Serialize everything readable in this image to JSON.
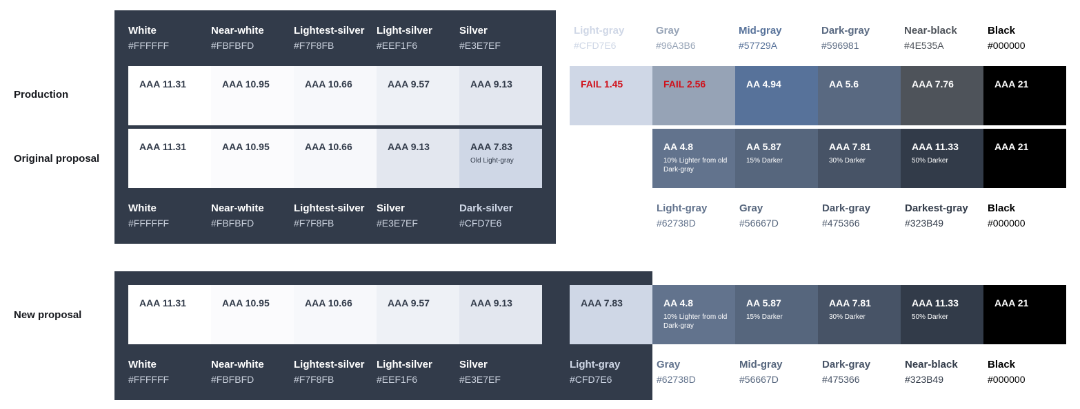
{
  "rows": {
    "production": "Production",
    "original": "Original proposal",
    "new": "New proposal"
  },
  "production": {
    "labels": [
      {
        "name": "White",
        "hex": "#FFFFFF",
        "name_color": "#ffffff",
        "hex_color": "#c9d0dc"
      },
      {
        "name": "Near-white",
        "hex": "#FBFBFD",
        "name_color": "#ffffff",
        "hex_color": "#c9d0dc"
      },
      {
        "name": "Lightest-silver",
        "hex": "#F7F8FB",
        "name_color": "#ffffff",
        "hex_color": "#c9d0dc"
      },
      {
        "name": "Light-silver",
        "hex": "#EEF1F6",
        "name_color": "#ffffff",
        "hex_color": "#c9d0dc"
      },
      {
        "name": "Silver",
        "hex": "#E3E7EF",
        "name_color": "#ffffff",
        "hex_color": "#c9d0dc"
      },
      {
        "name": "Light-gray",
        "hex": "#CFD7E6",
        "name_color": "#CFD7E6",
        "hex_color": "#CFD7E6"
      },
      {
        "name": "Gray",
        "hex": "#96A3B6",
        "name_color": "#96A3B6",
        "hex_color": "#96A3B6"
      },
      {
        "name": "Mid-gray",
        "hex": "#57729A",
        "name_color": "#57729A",
        "hex_color": "#57729A"
      },
      {
        "name": "Dark-gray",
        "hex": "#596981",
        "name_color": "#596981",
        "hex_color": "#596981"
      },
      {
        "name": "Near-black",
        "hex": "#4E535A",
        "name_color": "#4E535A",
        "hex_color": "#4E535A"
      },
      {
        "name": "Black",
        "hex": "#000000",
        "name_color": "#000000",
        "hex_color": "#000000"
      }
    ],
    "swatches": [
      {
        "score": "AAA 11.31",
        "bg": "#FFFFFF",
        "fg": "#323b4a"
      },
      {
        "score": "AAA 10.95",
        "bg": "#FBFBFD",
        "fg": "#323b4a"
      },
      {
        "score": "AAA 10.66",
        "bg": "#F7F8FB",
        "fg": "#323b4a"
      },
      {
        "score": "AAA 9.57",
        "bg": "#EEF1F6",
        "fg": "#323b4a"
      },
      {
        "score": "AAA 9.13",
        "bg": "#E3E7EF",
        "fg": "#323b4a"
      },
      {
        "score": "FAIL 1.45",
        "bg": "#CFD7E6",
        "fg": "#d0111b"
      },
      {
        "score": "FAIL 2.56",
        "bg": "#96A3B6",
        "fg": "#d0111b"
      },
      {
        "score": "AA 4.94",
        "bg": "#57729A",
        "fg": "#ffffff"
      },
      {
        "score": "AA 5.6",
        "bg": "#596981",
        "fg": "#ffffff"
      },
      {
        "score": "AAA 7.76",
        "bg": "#4E535A",
        "fg": "#ffffff"
      },
      {
        "score": "AAA 21",
        "bg": "#000000",
        "fg": "#ffffff"
      }
    ]
  },
  "original": {
    "swatches": [
      {
        "score": "AAA 11.31",
        "bg": "#FFFFFF",
        "fg": "#323b4a",
        "note": ""
      },
      {
        "score": "AAA 10.95",
        "bg": "#FBFBFD",
        "fg": "#323b4a",
        "note": ""
      },
      {
        "score": "AAA 10.66",
        "bg": "#F7F8FB",
        "fg": "#323b4a",
        "note": ""
      },
      {
        "score": "AAA 9.13",
        "bg": "#E3E7EF",
        "fg": "#323b4a",
        "note": ""
      },
      {
        "score": "AAA 7.83",
        "bg": "#CFD7E6",
        "fg": "#323b4a",
        "note": "Old Light-gray"
      },
      {
        "score": "AA 4.8",
        "bg": "#62738D",
        "fg": "#ffffff",
        "note": "10% Lighter from old Dark-gray"
      },
      {
        "score": "AA 5.87",
        "bg": "#56667D",
        "fg": "#ffffff",
        "note": "15% Darker"
      },
      {
        "score": "AAA 7.81",
        "bg": "#475366",
        "fg": "#ffffff",
        "note": "30% Darker"
      },
      {
        "score": "AAA 11.33",
        "bg": "#323B49",
        "fg": "#ffffff",
        "note": "50% Darker"
      },
      {
        "score": "AAA 21",
        "bg": "#000000",
        "fg": "#ffffff",
        "note": ""
      }
    ],
    "labels": [
      {
        "name": "White",
        "hex": "#FFFFFF",
        "name_color": "#ffffff",
        "hex_color": "#c9d0dc"
      },
      {
        "name": "Near-white",
        "hex": "#FBFBFD",
        "name_color": "#ffffff",
        "hex_color": "#c9d0dc"
      },
      {
        "name": "Lightest-silver",
        "hex": "#F7F8FB",
        "name_color": "#ffffff",
        "hex_color": "#c9d0dc"
      },
      {
        "name": "Silver",
        "hex": "#E3E7EF",
        "name_color": "#ffffff",
        "hex_color": "#c9d0dc"
      },
      {
        "name": "Dark-silver",
        "hex": "#CFD7E6",
        "name_color": "#CFD7E6",
        "hex_color": "#CFD7E6"
      },
      {
        "name": "Light-gray",
        "hex": "#62738D",
        "name_color": "#62738D",
        "hex_color": "#62738D"
      },
      {
        "name": "Gray",
        "hex": "#56667D",
        "name_color": "#56667D",
        "hex_color": "#56667D"
      },
      {
        "name": "Dark-gray",
        "hex": "#475366",
        "name_color": "#475366",
        "hex_color": "#475366"
      },
      {
        "name": "Darkest-gray",
        "hex": "#323B49",
        "name_color": "#323B49",
        "hex_color": "#323B49"
      },
      {
        "name": "Black",
        "hex": "#000000",
        "name_color": "#000000",
        "hex_color": "#000000"
      }
    ]
  },
  "new": {
    "swatches": [
      {
        "score": "AAA 11.31",
        "bg": "#FFFFFF",
        "fg": "#323b4a",
        "note": ""
      },
      {
        "score": "AAA 10.95",
        "bg": "#FBFBFD",
        "fg": "#323b4a",
        "note": ""
      },
      {
        "score": "AAA 10.66",
        "bg": "#F7F8FB",
        "fg": "#323b4a",
        "note": ""
      },
      {
        "score": "AAA 9.57",
        "bg": "#EEF1F6",
        "fg": "#323b4a",
        "note": ""
      },
      {
        "score": "AAA 9.13",
        "bg": "#E3E7EF",
        "fg": "#323b4a",
        "note": ""
      },
      {
        "score": "AAA 7.83",
        "bg": "#CFD7E6",
        "fg": "#323b4a",
        "note": ""
      },
      {
        "score": "AA 4.8",
        "bg": "#62738D",
        "fg": "#ffffff",
        "note": "10% Lighter from old Dark-gray"
      },
      {
        "score": "AA 5.87",
        "bg": "#56667D",
        "fg": "#ffffff",
        "note": "15% Darker"
      },
      {
        "score": "AAA 7.81",
        "bg": "#475366",
        "fg": "#ffffff",
        "note": "30% Darker"
      },
      {
        "score": "AAA 11.33",
        "bg": "#323B49",
        "fg": "#ffffff",
        "note": "50% Darker"
      },
      {
        "score": "AAA 21",
        "bg": "#000000",
        "fg": "#ffffff",
        "note": ""
      }
    ],
    "labels": [
      {
        "name": "White",
        "hex": "#FFFFFF",
        "name_color": "#ffffff",
        "hex_color": "#c9d0dc"
      },
      {
        "name": "Near-white",
        "hex": "#FBFBFD",
        "name_color": "#ffffff",
        "hex_color": "#c9d0dc"
      },
      {
        "name": "Lightest-silver",
        "hex": "#F7F8FB",
        "name_color": "#ffffff",
        "hex_color": "#c9d0dc"
      },
      {
        "name": "Light-silver",
        "hex": "#EEF1F6",
        "name_color": "#ffffff",
        "hex_color": "#c9d0dc"
      },
      {
        "name": "Silver",
        "hex": "#E3E7EF",
        "name_color": "#ffffff",
        "hex_color": "#c9d0dc"
      },
      {
        "name": "Light-gray",
        "hex": "#CFD7E6",
        "name_color": "#CFD7E6",
        "hex_color": "#CFD7E6"
      },
      {
        "name": "Gray",
        "hex": "#62738D",
        "name_color": "#62738D",
        "hex_color": "#62738D"
      },
      {
        "name": "Mid-gray",
        "hex": "#56667D",
        "name_color": "#56667D",
        "hex_color": "#56667D"
      },
      {
        "name": "Dark-gray",
        "hex": "#475366",
        "name_color": "#475366",
        "hex_color": "#475366"
      },
      {
        "name": "Near-black",
        "hex": "#323B49",
        "name_color": "#323B49",
        "hex_color": "#323B49"
      },
      {
        "name": "Black",
        "hex": "#000000",
        "name_color": "#000000",
        "hex_color": "#000000"
      }
    ]
  }
}
